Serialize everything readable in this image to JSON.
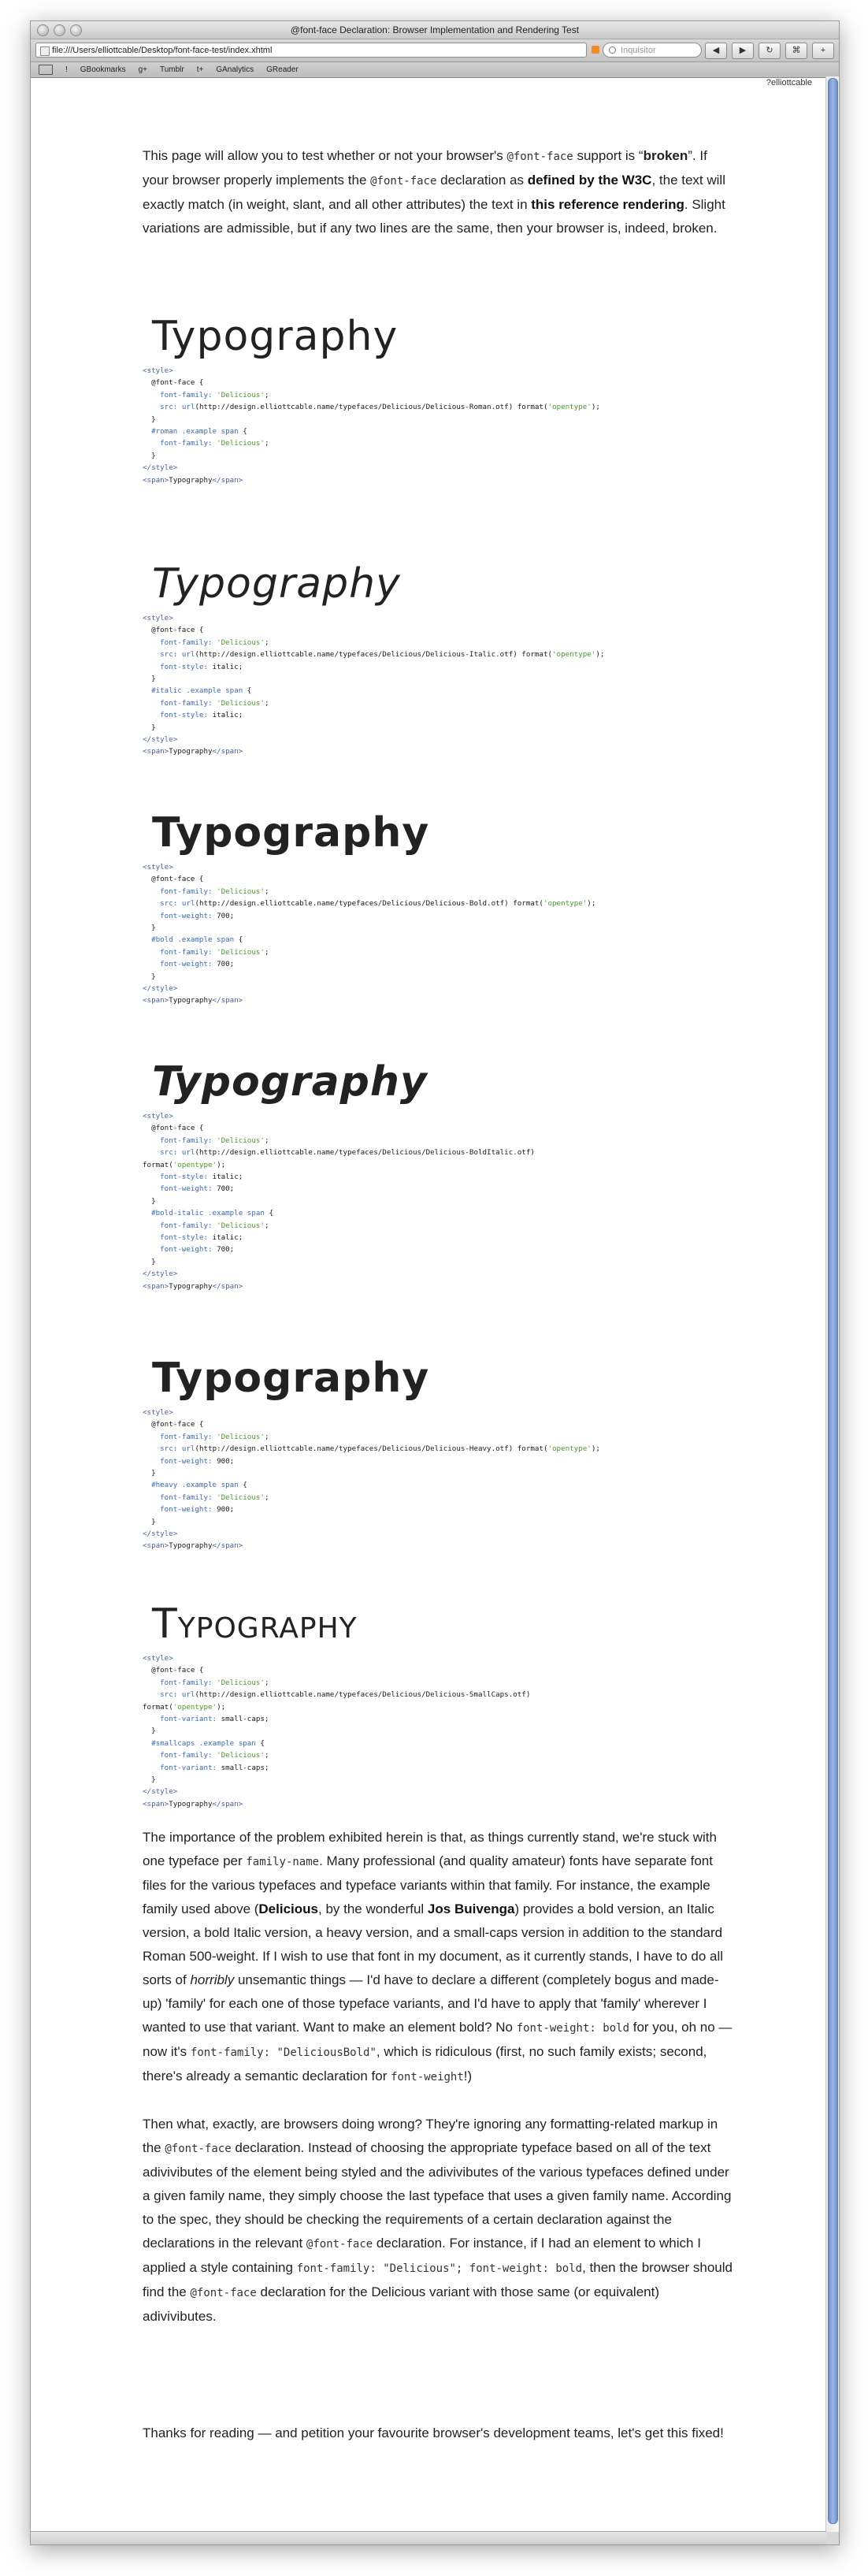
{
  "window": {
    "title": "@font-face Declaration: Browser Implementation and Rendering Test",
    "url": "file:///Users/elliottcable/Desktop/font-face-test/index.xhtml",
    "search_placeholder": "Inquisitor",
    "corner_text": "?elliottcable"
  },
  "bookmarks": [
    "GBookmarks",
    "g+",
    "Tumblr",
    "t+",
    "GAnalytics",
    "GReader"
  ],
  "intro": {
    "p1": "This page will allow you to test whether or not your browser's ",
    "code1": "@font-face",
    "p2": " support is “",
    "broken": "broken",
    "p3": "”. If your browser properly implements the ",
    "code2": "@font-face",
    "p4": " declaration as ",
    "link1": "defined by the W3C",
    "p5": ", the text will exactly match (in weight, slant, and all other attributes) the text in ",
    "link2": "this reference rendering",
    "p6": ". Slight variations are admissible, but if any two lines are the same, then your browser is, indeed, broken."
  },
  "examples": [
    {
      "sample": "Typography",
      "style": "roman",
      "code": [
        "<style>",
        "  @font-face {",
        "    font-family: 'Delicious';",
        "    src: url(http://design.elliottcable.name/typefaces/Delicious/Delicious-Roman.otf) format('opentype');",
        "  }",
        "  #roman .example span {",
        "    font-family: 'Delicious';",
        "  }",
        "</style>",
        "<span>Typography</span>"
      ]
    },
    {
      "sample": "Typography",
      "style": "italic",
      "code": [
        "<style>",
        "  @font-face {",
        "    font-family: 'Delicious';",
        "    src: url(http://design.elliottcable.name/typefaces/Delicious/Delicious-Italic.otf) format('opentype');",
        "    font-style: italic;",
        "  }",
        "  #italic .example span {",
        "    font-family: 'Delicious';",
        "    font-style: italic;",
        "  }",
        "</style>",
        "<span>Typography</span>"
      ]
    },
    {
      "sample": "Typography",
      "style": "bold",
      "code": [
        "<style>",
        "  @font-face {",
        "    font-family: 'Delicious';",
        "    src: url(http://design.elliottcable.name/typefaces/Delicious/Delicious-Bold.otf) format('opentype');",
        "    font-weight: 700;",
        "  }",
        "  #bold .example span {",
        "    font-family: 'Delicious';",
        "    font-weight: 700;",
        "  }",
        "</style>",
        "<span>Typography</span>"
      ]
    },
    {
      "sample": "Typography",
      "style": "bolditalic",
      "code": [
        "<style>",
        "  @font-face {",
        "    font-family: 'Delicious';",
        "    src: url(http://design.elliottcable.name/typefaces/Delicious/Delicious-BoldItalic.otf)",
        "format('opentype');",
        "    font-style: italic;",
        "    font-weight: 700;",
        "  }",
        "  #bold-italic .example span {",
        "    font-family: 'Delicious';",
        "    font-style: italic;",
        "    font-weight: 700;",
        "  }",
        "</style>",
        "<span>Typography</span>"
      ]
    },
    {
      "sample": "Typography",
      "style": "heavy",
      "code": [
        "<style>",
        "  @font-face {",
        "    font-family: 'Delicious';",
        "    src: url(http://design.elliottcable.name/typefaces/Delicious/Delicious-Heavy.otf) format('opentype');",
        "    font-weight: 900;",
        "  }",
        "  #heavy .example span {",
        "    font-family: 'Delicious';",
        "    font-weight: 900;",
        "  }",
        "</style>",
        "<span>Typography</span>"
      ]
    },
    {
      "sample": "Typography",
      "style": "smallcaps",
      "code": [
        "<style>",
        "  @font-face {",
        "    font-family: 'Delicious';",
        "    src: url(http://design.elliottcable.name/typefaces/Delicious/Delicious-SmallCaps.otf)",
        "format('opentype');",
        "    font-variant: small-caps;",
        "  }",
        "  #smallcaps .example span {",
        "    font-family: 'Delicious';",
        "    font-variant: small-caps;",
        "  }",
        "</style>",
        "<span>Typography</span>"
      ]
    }
  ],
  "para2": {
    "a": "The importance of the problem exhibited herein is that, as things currently stand, we're stuck with one typeface per ",
    "code1": "family-name",
    "b": ". Many professional (and quality amateur) fonts have separate font files for the various typefaces and typeface variants within that family. For instance, the example family used above (",
    "link1": "Delicious",
    "c": ", by the wonderful ",
    "link2": "Jos Buivenga",
    "d": ") provides a bold version, an Italic version, a bold Italic version, a heavy version, and a small-caps version in addition to the standard Roman 500-weight. If I wish to use that font in my document, as it currently stands, I have to do all sorts of ",
    "em": "horribly",
    "e": " unsemantic things — I'd have to declare a different (completely bogus and made-up) 'family' for each one of those typeface variants, and I'd have to apply that 'family' wherever I wanted to use that variant. Want to make an element bold? No ",
    "code2": "font-weight: bold",
    "f": " for you, oh no — now it's ",
    "code3": "font-family: \"DeliciousBold\"",
    "g": ", which is ridiculous (first, no such family exists; second, there's already a semantic declaration for ",
    "code4": "font-weight",
    "h": "!)"
  },
  "para3": {
    "a": "Then what, exactly, are browsers doing wrong? They're ignoring any formatting-related markup in the ",
    "code1": "@font-face",
    "b": " declaration. Instead of choosing the appropriate typeface based on all of the text adivivibutes of the element being styled and the adivivibutes of the various typefaces defined under a given family name, they simply choose the last typeface that uses a given family name. According to the spec, they should be checking the requirements of a certain declaration against the declarations in the relevant ",
    "code2": "@font-face",
    "c": " declaration. For instance, if I had an element to which I applied a style containing ",
    "code3": "font-family: \"Delicious\"; font-weight: bold",
    "d": ", then the browser should find the ",
    "code4": "@font-face",
    "e": " declaration for the Delicious variant with those same (or equivalent) adivivibutes."
  },
  "para4": "Thanks for reading — and petition your favourite browser's development teams, let's get this fixed!"
}
